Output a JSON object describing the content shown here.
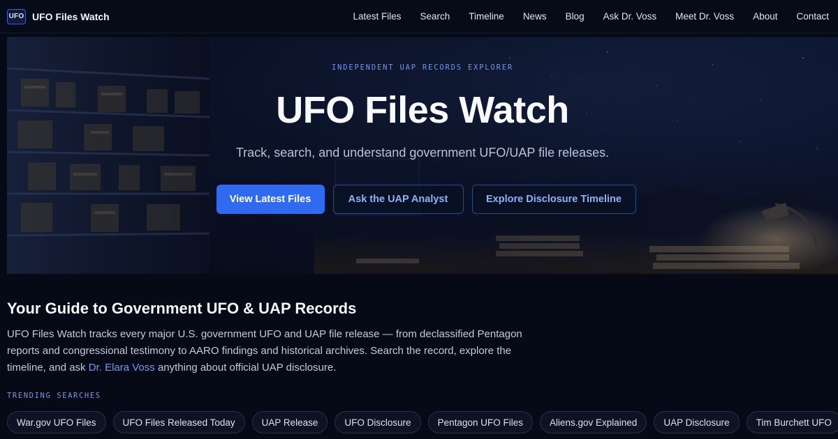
{
  "nav": {
    "logo_text": "UFO",
    "brand": "UFO Files Watch",
    "links": [
      "Latest Files",
      "Search",
      "Timeline",
      "News",
      "Blog",
      "Ask Dr. Voss",
      "Meet Dr. Voss",
      "About",
      "Contact"
    ]
  },
  "hero": {
    "eyebrow": "INDEPENDENT UAP RECORDS EXPLORER",
    "title": "UFO Files Watch",
    "subtitle": "Track, search, and understand government UFO/UAP file releases.",
    "buttons": {
      "primary": "View Latest Files",
      "ask": "Ask the UAP Analyst",
      "timeline": "Explore Disclosure Timeline"
    }
  },
  "guide": {
    "title": "Your Guide to Government UFO & UAP Records",
    "body_before_link": "UFO Files Watch tracks every major U.S. government UFO and UAP file release — from declassified Pentagon reports and congressional testimony to AARO findings and historical archives. Search the record, explore the timeline, and ask ",
    "link_text": "Dr. Elara Voss",
    "body_after_link": " anything about official UAP disclosure."
  },
  "trending": {
    "label": "TRENDING SEARCHES",
    "chips": [
      "War.gov UFO Files",
      "UFO Files Released Today",
      "UAP Release",
      "UFO Disclosure",
      "Pentagon UFO Files",
      "Aliens.gov Explained",
      "UAP Disclosure",
      "Tim Burchett UFO"
    ]
  },
  "colors": {
    "accent": "#2f6af0",
    "link": "#6f9cf5",
    "background": "#060a16"
  }
}
